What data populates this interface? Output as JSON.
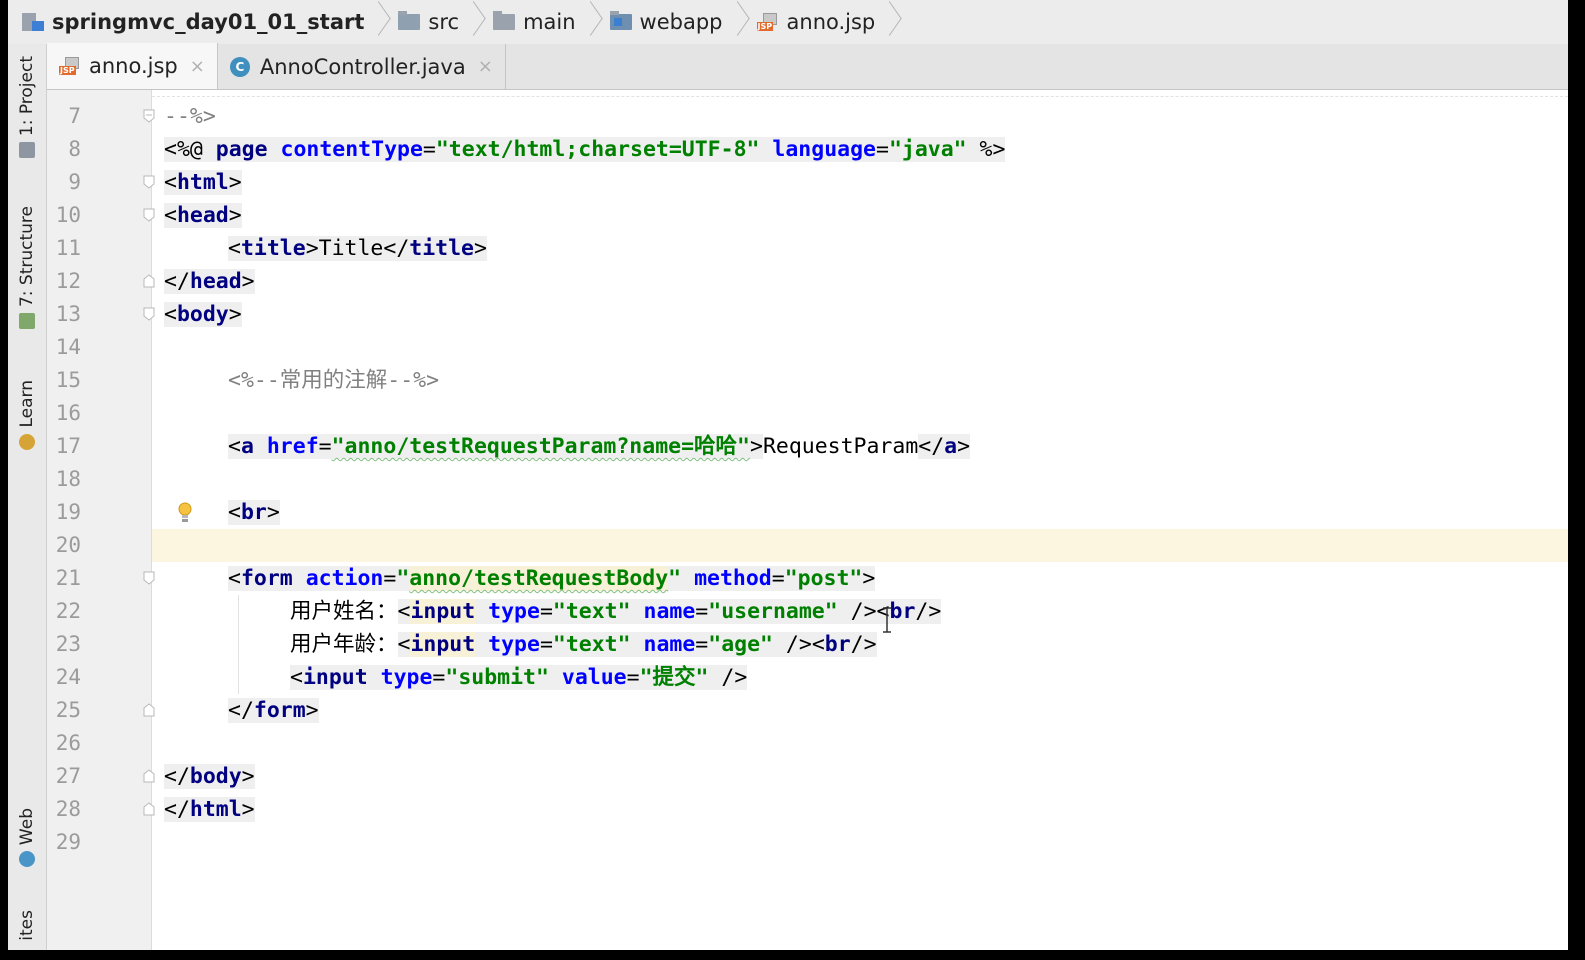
{
  "breadcrumb": [
    {
      "label": "springmvc_day01_01_start",
      "icon": "project-module-icon"
    },
    {
      "label": "src",
      "icon": "folder-icon"
    },
    {
      "label": "main",
      "icon": "folder-icon"
    },
    {
      "label": "webapp",
      "icon": "web-folder-icon"
    },
    {
      "label": "anno.jsp",
      "icon": "jsp-file-icon"
    }
  ],
  "tool_strip": {
    "project": "1: Project",
    "structure": "7: Structure",
    "learn": "Learn",
    "web": "Web",
    "favorites": "ites"
  },
  "tabs": [
    {
      "label": "anno.jsp",
      "icon": "jsp-file-icon",
      "active": true,
      "close": "×"
    },
    {
      "label": "AnnoController.java",
      "icon": "java-class-icon",
      "active": false,
      "close": "×"
    }
  ],
  "editor": {
    "current_line": 20,
    "lines": [
      {
        "n": "7",
        "text": "--%>"
      },
      {
        "n": "8",
        "text": "<%@ page contentType=\"text/html;charset=UTF-8\" language=\"java\" %>"
      },
      {
        "n": "9",
        "text": "<html>"
      },
      {
        "n": "10",
        "text": "<head>"
      },
      {
        "n": "11",
        "text": "    <title>Title</title>"
      },
      {
        "n": "12",
        "text": "</head>"
      },
      {
        "n": "13",
        "text": "<body>"
      },
      {
        "n": "14",
        "text": ""
      },
      {
        "n": "15",
        "text": "    <%--常用的注解--%>"
      },
      {
        "n": "16",
        "text": ""
      },
      {
        "n": "17",
        "text": "    <a href=\"anno/testRequestParam?name=哈哈\">RequestParam</a>"
      },
      {
        "n": "18",
        "text": ""
      },
      {
        "n": "19",
        "text": "    <br>"
      },
      {
        "n": "20",
        "text": ""
      },
      {
        "n": "21",
        "text": "    <form action=\"anno/testRequestBody\" method=\"post\">"
      },
      {
        "n": "22",
        "text": "        用户姓名：<input type=\"text\" name=\"username\" /><br/>"
      },
      {
        "n": "23",
        "text": "        用户年龄：<input type=\"text\" name=\"age\" /><br/>"
      },
      {
        "n": "24",
        "text": "        <input type=\"submit\" value=\"提交\" />"
      },
      {
        "n": "25",
        "text": "    </form>"
      },
      {
        "n": "26",
        "text": ""
      },
      {
        "n": "27",
        "text": "</body>"
      },
      {
        "n": "28",
        "text": "</html>"
      },
      {
        "n": "29",
        "text": ""
      }
    ]
  },
  "tokens": {
    "l7": [
      "--%>"
    ],
    "l8": [
      "<%@ ",
      "page",
      " ",
      "contentType",
      "=",
      "\"text/html;charset=UTF-8\"",
      " ",
      "language",
      "=",
      "\"java\"",
      " %>"
    ],
    "l9": [
      "<",
      "html",
      ">"
    ],
    "l10": [
      "<",
      "head",
      ">"
    ],
    "l11": [
      "<",
      "title",
      ">",
      "Title",
      "</",
      "title",
      ">"
    ],
    "l12": [
      "</",
      "head",
      ">"
    ],
    "l13": [
      "<",
      "body",
      ">"
    ],
    "l15": [
      "<%--常用的注解--%>"
    ],
    "l17": [
      "<",
      "a",
      " ",
      "href",
      "=",
      "\"anno/testRequestParam?name=哈哈\"",
      ">",
      "RequestParam",
      "</",
      "a",
      ">"
    ],
    "l19": [
      "<",
      "br",
      ">"
    ],
    "l21": [
      "<",
      "form",
      " ",
      "action",
      "=",
      "\"",
      "anno/testRequestBody",
      "\"",
      " ",
      "method",
      "=",
      "\"post\"",
      ">"
    ],
    "l22": [
      "用户姓名：",
      "<",
      "input",
      " ",
      "type",
      "=",
      "\"text\"",
      " ",
      "name",
      "=",
      "\"username\"",
      " />",
      "<",
      "br",
      "/>"
    ],
    "l23": [
      "用户年龄：",
      "<",
      "input",
      " ",
      "type",
      "=",
      "\"text\"",
      " ",
      "name",
      "=",
      "\"age\"",
      " />",
      "<",
      "br",
      "/>"
    ],
    "l24": [
      "<",
      "input",
      " ",
      "type",
      "=",
      "\"submit\"",
      " ",
      "value",
      "=",
      "\"提交\"",
      " />"
    ],
    "l25": [
      "</",
      "form",
      ">"
    ],
    "l27": [
      "</",
      "body",
      ">"
    ],
    "l28": [
      "</",
      "html",
      ">"
    ]
  },
  "colors": {
    "tag": "#000080",
    "attribute": "#0000ff",
    "string": "#008000",
    "comment": "#808080",
    "current_line": "#fcf6e1"
  }
}
